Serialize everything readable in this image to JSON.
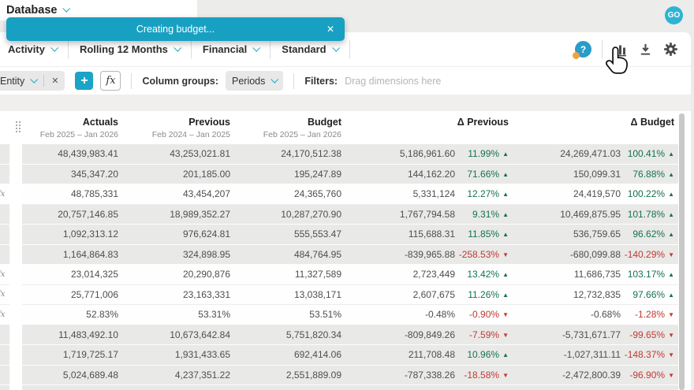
{
  "colors": {
    "accent": "#1ba4c6",
    "toast": "#18a0c2",
    "green": "#15724d",
    "red": "#bf3a32",
    "row_gray": "#e9e9e8",
    "band": "#f0efee",
    "page_bg": "#ececeb",
    "icon": "#4a4a4a",
    "avatar": "#2eb3d3",
    "help": "#2a9cc9"
  },
  "glyphs": {
    "up": "▲",
    "down": "▼"
  },
  "topbar": {
    "title": "Database",
    "avatar_initials": "GO"
  },
  "toast": {
    "message": "Creating budget...",
    "close": "✕"
  },
  "toolbar": {
    "dropdowns": [
      "Activity",
      "Rolling 12 Months",
      "Financial",
      "Standard"
    ],
    "help_label": "?"
  },
  "filter_bar": {
    "entity_label": "Entity",
    "entity_close": "✕",
    "add_button": "+",
    "fx_button": "fx",
    "column_groups_label": "Column groups:",
    "column_groups_value": "Periods",
    "filters_label": "Filters:",
    "filters_placeholder": "Drag dimensions here"
  },
  "table": {
    "fx_label": "fx",
    "columns": [
      {
        "label": "Actuals",
        "sub": "Feb 2025 – Jan 2026"
      },
      {
        "label": "Previous",
        "sub": "Feb 2024 – Jan 2025"
      },
      {
        "label": "Budget",
        "sub": "Feb 2025 – Jan 2026"
      },
      {
        "label": "Δ Previous",
        "sub": ""
      },
      {
        "label": "Δ Budget",
        "sub": ""
      }
    ],
    "rows": [
      {
        "a": "48,439,983.41",
        "p": "43,253,021.81",
        "b": "24,170,512.38",
        "dp": "5,186,961.60",
        "dpp": "11.99%",
        "dpd": "up",
        "db": "24,269,471.03",
        "dbp": "100.41%",
        "dbd": "up",
        "fx": false,
        "shade": "gray"
      },
      {
        "a": "345,347.20",
        "p": "201,185.00",
        "b": "195,247.89",
        "dp": "144,162.20",
        "dpp": "71.66%",
        "dpd": "up",
        "db": "150,099.31",
        "dbp": "76.88%",
        "dbd": "up",
        "fx": false,
        "shade": "gray"
      },
      {
        "a": "48,785,331",
        "p": "43,454,207",
        "b": "24,365,760",
        "dp": "5,331,124",
        "dpp": "12.27%",
        "dpd": "up",
        "db": "24,419,570",
        "dbp": "100.22%",
        "dbd": "up",
        "fx": true,
        "shade": "white"
      },
      {
        "a": "20,757,146.85",
        "p": "18,989,352.27",
        "b": "10,287,270.90",
        "dp": "1,767,794.58",
        "dpp": "9.31%",
        "dpd": "up",
        "db": "10,469,875.95",
        "dbp": "101.78%",
        "dbd": "up",
        "fx": false,
        "shade": "gray"
      },
      {
        "a": "1,092,313.12",
        "p": "976,624.81",
        "b": "555,553.47",
        "dp": "115,688.31",
        "dpp": "11.85%",
        "dpd": "up",
        "db": "536,759.65",
        "dbp": "96.62%",
        "dbd": "up",
        "fx": false,
        "shade": "gray"
      },
      {
        "a": "1,164,864.83",
        "p": "324,898.95",
        "b": "484,764.95",
        "dp": "-839,965.88",
        "dpp": "-258.53%",
        "dpd": "down",
        "db": "-680,099.88",
        "dbp": "-140.29%",
        "dbd": "down",
        "fx": false,
        "shade": "gray"
      },
      {
        "a": "23,014,325",
        "p": "20,290,876",
        "b": "11,327,589",
        "dp": "2,723,449",
        "dpp": "13.42%",
        "dpd": "up",
        "db": "11,686,735",
        "dbp": "103.17%",
        "dbd": "up",
        "fx": true,
        "shade": "white"
      },
      {
        "a": "25,771,006",
        "p": "23,163,331",
        "b": "13,038,171",
        "dp": "2,607,675",
        "dpp": "11.26%",
        "dpd": "up",
        "db": "12,732,835",
        "dbp": "97.66%",
        "dbd": "up",
        "fx": true,
        "shade": "white"
      },
      {
        "a": "52.83%",
        "p": "53.31%",
        "b": "53.51%",
        "dp": "-0.48%",
        "dpp": "-0.90%",
        "dpd": "down",
        "db": "-0.68%",
        "dbp": "-1.28%",
        "dbd": "down",
        "fx": true,
        "shade": "white"
      },
      {
        "a": "11,483,492.10",
        "p": "10,673,642.84",
        "b": "5,751,820.34",
        "dp": "-809,849.26",
        "dpp": "-7.59%",
        "dpd": "down",
        "db": "-5,731,671.77",
        "dbp": "-99.65%",
        "dbd": "down",
        "fx": false,
        "shade": "gray"
      },
      {
        "a": "1,719,725.17",
        "p": "1,931,433.65",
        "b": "692,414.06",
        "dp": "211,708.48",
        "dpp": "10.96%",
        "dpd": "up",
        "db": "-1,027,311.11",
        "dbp": "-148.37%",
        "dbd": "down",
        "fx": false,
        "shade": "gray"
      },
      {
        "a": "5,024,689.48",
        "p": "4,237,351.22",
        "b": "2,551,889.09",
        "dp": "-787,338.26",
        "dpp": "-18.58%",
        "dpd": "down",
        "db": "-2,472,800.39",
        "dbp": "-96.90%",
        "dbd": "down",
        "fx": false,
        "shade": "gray"
      }
    ]
  }
}
